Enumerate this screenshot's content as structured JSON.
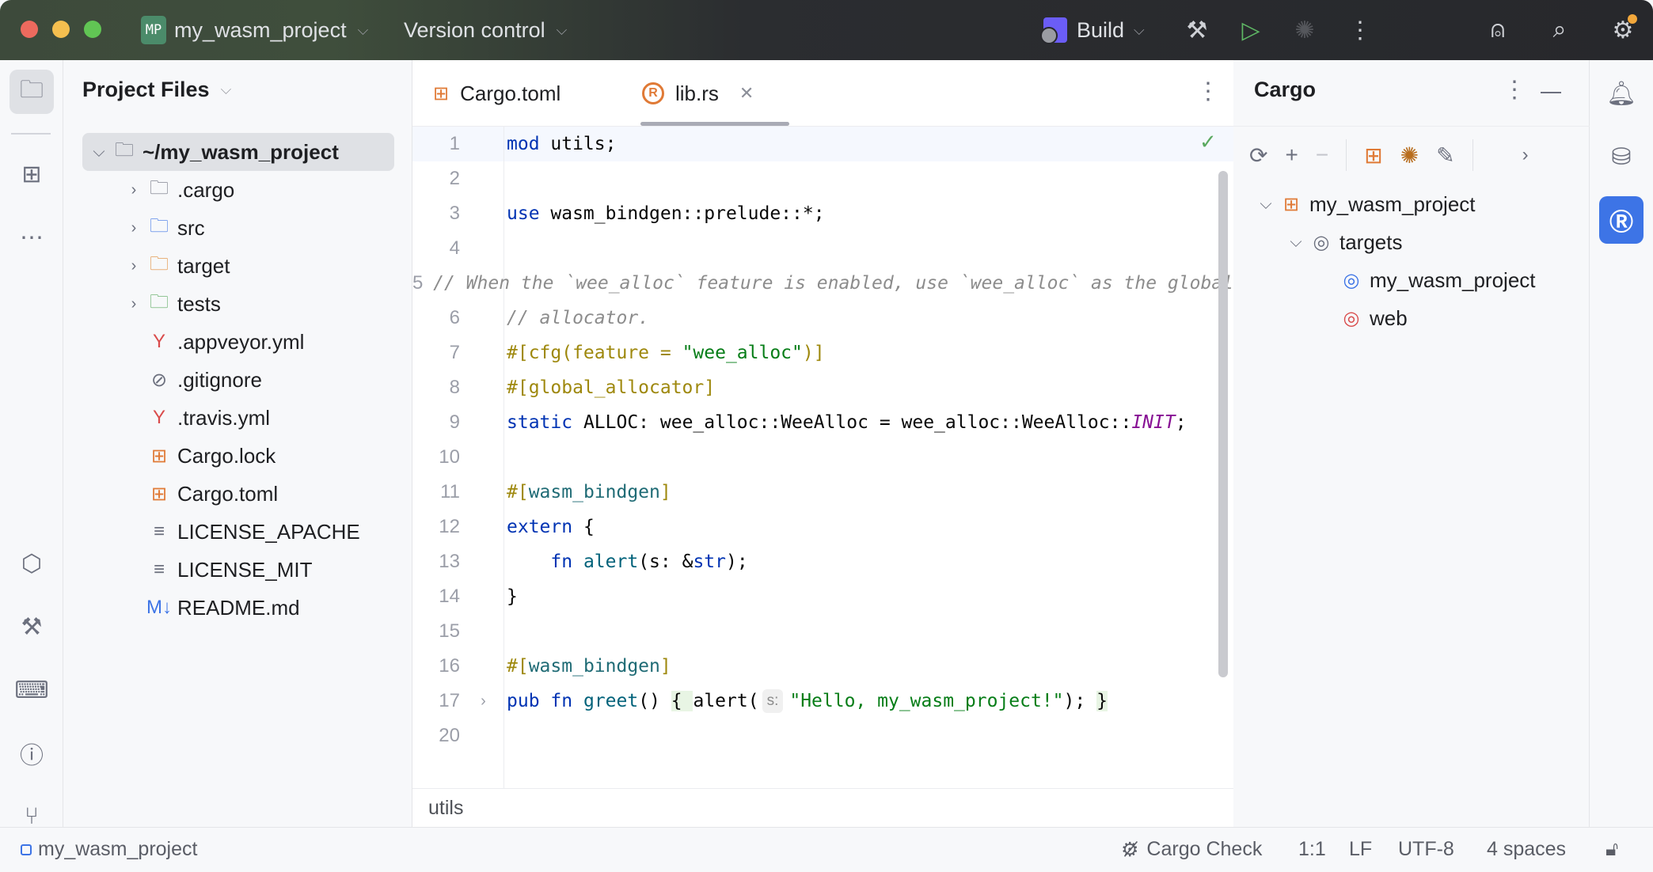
{
  "titlebar": {
    "project_badge": "MP",
    "project_name": "my_wasm_project",
    "vcs": "Version control",
    "run_config": "Build"
  },
  "project_panel": {
    "title": "Project Files",
    "items": [
      {
        "label": "~/my_wasm_project",
        "level": 0,
        "arrow": "down",
        "icon": "folder-icon",
        "selected": true
      },
      {
        "label": ".cargo",
        "level": 1,
        "arrow": "right",
        "icon": "folder-icon"
      },
      {
        "label": "src",
        "level": 1,
        "arrow": "right",
        "icon": "folder-blue-icon"
      },
      {
        "label": "target",
        "level": 1,
        "arrow": "right",
        "icon": "folder-orange-icon"
      },
      {
        "label": "tests",
        "level": 1,
        "arrow": "right",
        "icon": "folder-green-icon"
      },
      {
        "label": ".appveyor.yml",
        "level": 1,
        "icon": "yaml-icon"
      },
      {
        "label": ".gitignore",
        "level": 1,
        "icon": "ignore-icon"
      },
      {
        "label": ".travis.yml",
        "level": 1,
        "icon": "yaml-icon"
      },
      {
        "label": "Cargo.lock",
        "level": 1,
        "icon": "cargo-lock-icon"
      },
      {
        "label": "Cargo.toml",
        "level": 1,
        "icon": "cargo-icon"
      },
      {
        "label": "LICENSE_APACHE",
        "level": 1,
        "icon": "text-file-icon"
      },
      {
        "label": "LICENSE_MIT",
        "level": 1,
        "icon": "text-file-icon"
      },
      {
        "label": "README.md",
        "level": 1,
        "icon": "markdown-icon"
      }
    ]
  },
  "editor": {
    "tabs": [
      {
        "label": "Cargo.toml",
        "active": false
      },
      {
        "label": "lib.rs",
        "active": true
      }
    ],
    "breadcrumb": "utils",
    "lines": [
      {
        "n": "1",
        "t": [
          [
            "mod",
            "kw"
          ],
          [
            " utils;",
            ""
          ]
        ]
      },
      {
        "n": "2",
        "t": []
      },
      {
        "n": "3",
        "t": [
          [
            "use",
            "kw"
          ],
          [
            " wasm_bindgen::prelude::*;",
            ""
          ]
        ]
      },
      {
        "n": "4",
        "t": []
      },
      {
        "n": "5",
        "t": [
          [
            "// When the `wee_alloc` feature is enabled, use `wee_alloc` as the global",
            "cm"
          ]
        ]
      },
      {
        "n": "6",
        "t": [
          [
            "// allocator.",
            "cm"
          ]
        ]
      },
      {
        "n": "7",
        "t": [
          [
            "#[cfg(feature = ",
            "attr"
          ],
          [
            "\"wee_alloc\"",
            "str"
          ],
          [
            ")]",
            "attr"
          ]
        ]
      },
      {
        "n": "8",
        "t": [
          [
            "#[global_allocator]",
            "attr"
          ]
        ]
      },
      {
        "n": "9",
        "t": [
          [
            "static",
            "kw"
          ],
          [
            " ALLOC: wee_alloc::WeeAlloc = wee_alloc::WeeAlloc::",
            ""
          ],
          [
            "INIT",
            "const"
          ],
          [
            ";",
            ""
          ]
        ]
      },
      {
        "n": "10",
        "t": []
      },
      {
        "n": "11",
        "t": [
          [
            "#[",
            "attr"
          ],
          [
            "wasm_bindgen",
            "attrn"
          ],
          [
            "]",
            "attr"
          ]
        ]
      },
      {
        "n": "12",
        "t": [
          [
            "extern",
            "kw"
          ],
          [
            " {",
            ""
          ]
        ]
      },
      {
        "n": "13",
        "t": [
          [
            "    ",
            ""
          ],
          [
            "fn",
            "kw"
          ],
          [
            " ",
            ""
          ],
          [
            "alert",
            "fn"
          ],
          [
            "(s: &",
            ""
          ],
          [
            "str",
            "kw"
          ],
          [
            ");",
            ""
          ]
        ]
      },
      {
        "n": "14",
        "t": [
          [
            "}",
            ""
          ]
        ]
      },
      {
        "n": "15",
        "t": []
      },
      {
        "n": "16",
        "t": [
          [
            "#[",
            "attr"
          ],
          [
            "wasm_bindgen",
            "attrn"
          ],
          [
            "]",
            "attr"
          ]
        ]
      },
      {
        "n": "17",
        "fold": true,
        "t": [
          [
            "pub",
            "kw"
          ],
          [
            " ",
            ""
          ],
          [
            "fn",
            "kw"
          ],
          [
            " ",
            ""
          ],
          [
            "greet",
            "fn"
          ],
          [
            "() ",
            ""
          ],
          [
            "{ ",
            "brace"
          ],
          [
            "alert(",
            ""
          ],
          [
            "s:",
            "hint"
          ],
          [
            "\"Hello, my_wasm_project!\"",
            "str"
          ],
          [
            "); ",
            ""
          ],
          [
            "}",
            "brace"
          ]
        ]
      },
      {
        "n": "20",
        "t": []
      }
    ]
  },
  "cargo_panel": {
    "title": "Cargo",
    "tree": [
      {
        "label": "my_wasm_project",
        "level": 0,
        "arrow": "down",
        "icon": "cargo-icon"
      },
      {
        "label": "targets",
        "level": 1,
        "arrow": "down",
        "icon": "target-icon"
      },
      {
        "label": "my_wasm_project",
        "level": 2,
        "icon": "target-lib-icon"
      },
      {
        "label": "web",
        "level": 2,
        "icon": "target-bin-icon"
      }
    ]
  },
  "statusbar": {
    "project": "my_wasm_project",
    "cargo_check": "Cargo Check",
    "position": "1:1",
    "line_sep": "LF",
    "encoding": "UTF-8",
    "indent": "4 spaces"
  }
}
